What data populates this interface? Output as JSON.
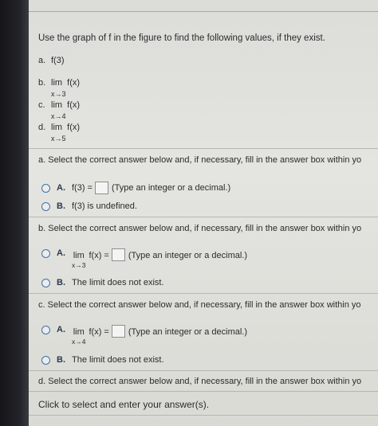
{
  "question": {
    "intro": "Use the graph of f in the figure to find the following values, if they exist.",
    "parts": [
      {
        "label": "a.",
        "expr": "f(3)",
        "sub": ""
      },
      {
        "label": "b.",
        "expr": "lim  f(x)",
        "sub": "x→3"
      },
      {
        "label": "c.",
        "expr": "lim  f(x)",
        "sub": "x→4"
      },
      {
        "label": "d.",
        "expr": "lim  f(x)",
        "sub": "x→5"
      }
    ]
  },
  "sections": {
    "a": {
      "prompt": "a. Select the correct answer below and, if necessary, fill in the answer box within yo",
      "optA_letter": "A.",
      "optA_pre": "f(3) =",
      "optA_hint": "(Type an integer or a decimal.)",
      "optB_letter": "B.",
      "optB_text": "f(3) is undefined."
    },
    "b": {
      "prompt": "b. Select the correct answer below and, if necessary, fill in the answer box within yo",
      "optA_letter": "A.",
      "optA_lim": "lim",
      "optA_fx": "f(x) =",
      "optA_sub": "x→3",
      "optA_hint": "(Type an integer or a decimal.)",
      "optB_letter": "B.",
      "optB_text": "The limit does not exist."
    },
    "c": {
      "prompt": "c. Select the correct answer below and, if necessary, fill in the answer box within yo",
      "optA_letter": "A.",
      "optA_lim": "lim",
      "optA_fx": "f(x) =",
      "optA_sub": "x→4",
      "optA_hint": "(Type an integer or a decimal.)",
      "optB_letter": "B.",
      "optB_text": "The limit does not exist."
    },
    "d": {
      "prompt": "d. Select the correct answer below and, if necessary, fill in the answer box within yo"
    }
  },
  "footer": "Click to select and enter your answer(s)."
}
